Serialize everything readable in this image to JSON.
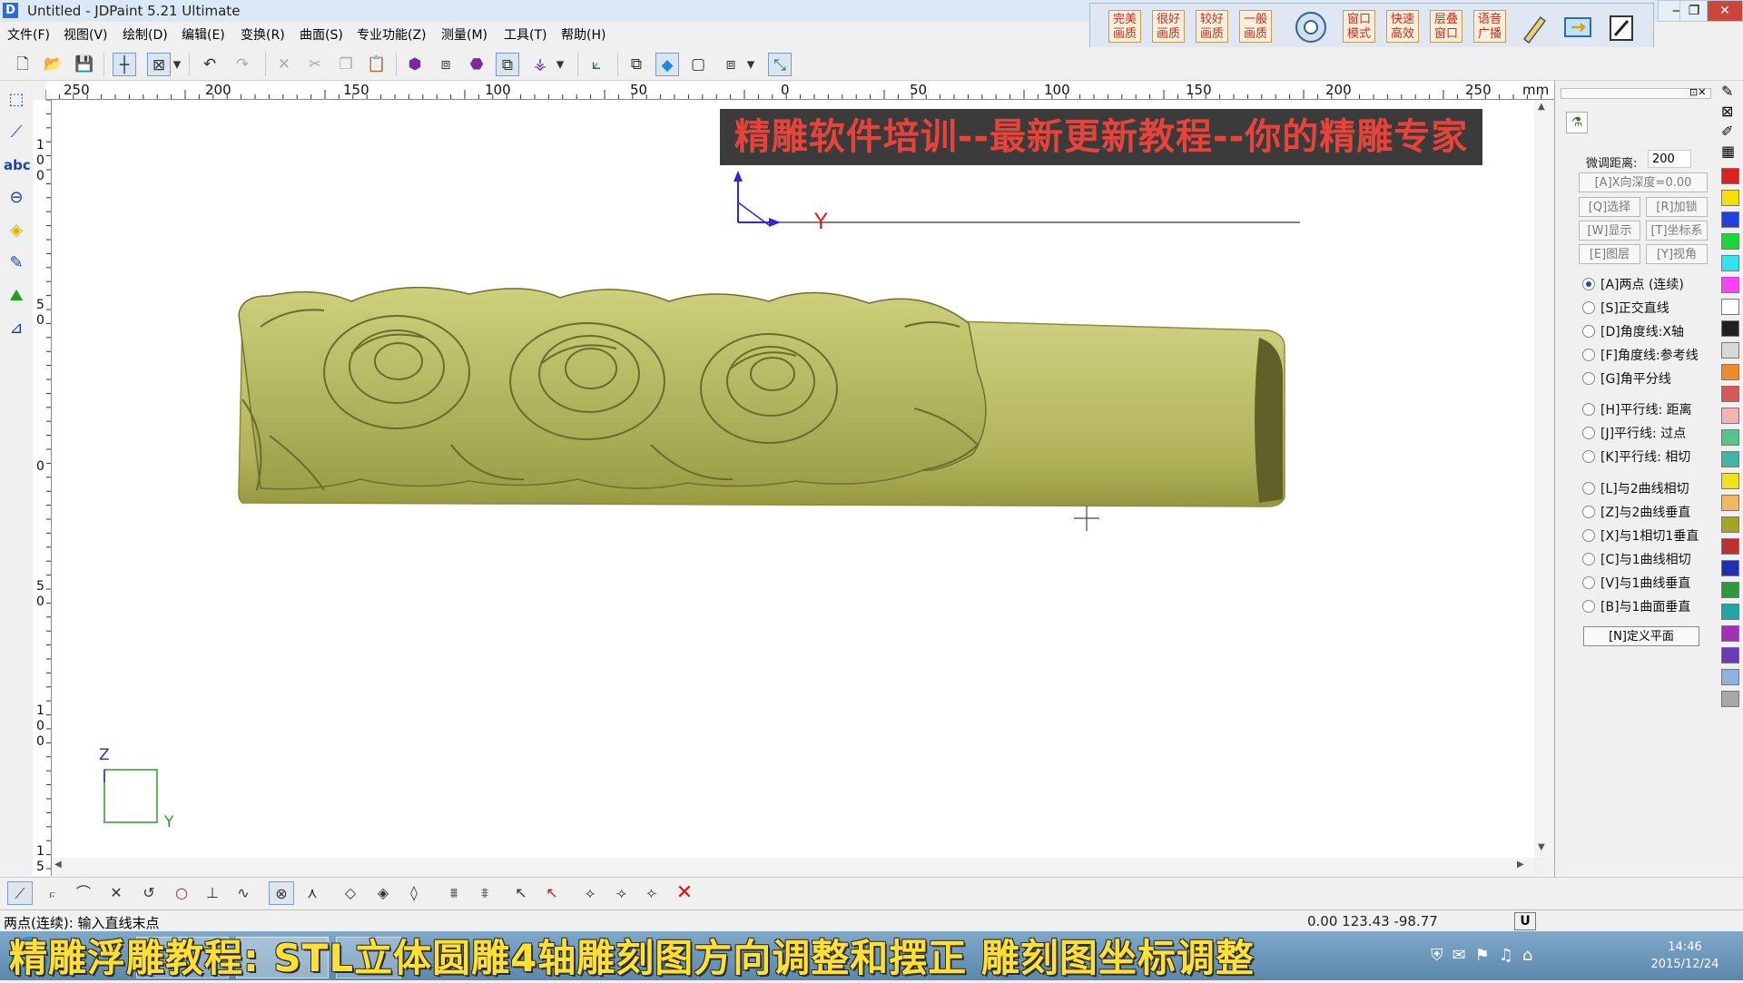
{
  "window": {
    "app_icon": "D",
    "title": "Untitled - JDPaint 5.21 Ultimate",
    "controls": {
      "minimize": "—",
      "restore": "❐",
      "close": "✕"
    }
  },
  "menu": [
    "文件(F)",
    "视图(V)",
    "绘制(D)",
    "编辑(E)",
    "变换(R)",
    "曲面(S)",
    "专业功能(Z)",
    "测量(M)",
    "工具(T)",
    "帮助(H)"
  ],
  "quick_panel": {
    "quality_buttons": [
      {
        "line1": "完美",
        "line2": "画质"
      },
      {
        "line1": "很好",
        "line2": "画质"
      },
      {
        "line1": "较好",
        "line2": "画质"
      },
      {
        "line1": "一般",
        "line2": "画质"
      }
    ],
    "mode_buttons": [
      {
        "line1": "窗口",
        "line2": "模式"
      },
      {
        "line1": "快速",
        "line2": "高效"
      },
      {
        "line1": "层叠",
        "line2": "窗口"
      },
      {
        "line1": "语音",
        "line2": "广播"
      }
    ]
  },
  "ruler": {
    "h_labels": [
      "250",
      "200",
      "150",
      "100",
      "50",
      "0",
      "50",
      "100",
      "150",
      "200",
      "250"
    ],
    "unit": "mm",
    "v_labels": [
      "1\n0\n0",
      "5\n0",
      "0",
      "5\n0",
      "1\n0\n0",
      "1\n5"
    ]
  },
  "canvas": {
    "banner": "精雕软件培训--最新更新教程--你的精雕专家",
    "axis_y_label": "Y",
    "corner_axis_z": "Z",
    "corner_axis_y": "Y"
  },
  "right_panel": {
    "fine_tune_label": "微调距离:",
    "fine_tune_value": "200",
    "depth_button": "[A]X向深度=0.00",
    "buttons": [
      "[Q]选择",
      "[R]加锁",
      "[W]显示",
      "[T]坐标系",
      "[E]图层",
      "[Y]视角"
    ],
    "options": [
      {
        "label": "[A]两点 (连续)",
        "checked": true
      },
      {
        "label": "[S]正交直线",
        "checked": false
      },
      {
        "label": "[D]角度线:X轴",
        "checked": false
      },
      {
        "label": "[F]角度线:参考线",
        "checked": false
      },
      {
        "label": "[G]角平分线",
        "checked": false
      },
      {
        "label": "[H]平行线: 距离",
        "checked": false
      },
      {
        "label": "[J]平行线: 过点",
        "checked": false
      },
      {
        "label": "[K]平行线: 相切",
        "checked": false
      },
      {
        "label": "[L]与2曲线相切",
        "checked": false
      },
      {
        "label": "[Z]与2曲线垂直",
        "checked": false
      },
      {
        "label": "[X]与1相切1垂直",
        "checked": false
      },
      {
        "label": "[C]与1曲线相切",
        "checked": false
      },
      {
        "label": "[V]与1曲线垂直",
        "checked": false
      },
      {
        "label": "[B]与1曲面垂直",
        "checked": false
      }
    ],
    "define_plane": "[N]定义平面"
  },
  "palette": [
    "#e02020",
    "#f5e100",
    "#2040e0",
    "#19d83a",
    "#2fe6f0",
    "#ff40ff",
    "#ffffff",
    "#202020",
    "#d8d8d8",
    "#ef8a2a",
    "#d65858",
    "#f4b3b3",
    "#57c48e",
    "#44b4a2",
    "#f2e21a",
    "#f2b760",
    "#a4a426",
    "#c03030",
    "#2030b0",
    "#2c9a3a",
    "#21a6a6",
    "#a22fb8",
    "#6a3bb8",
    "#8fb2de",
    "#a8a8a8"
  ],
  "status": {
    "prompt": "两点(连续): 输入直线末点",
    "coords": "0.00 123.43 -98.77",
    "mode": "U"
  },
  "caption": "精雕浮雕教程: STL立体圆雕4轴雕刻图方向调整和摆正 雕刻图坐标调整",
  "clock": {
    "time": "14:46",
    "date": "2015/12/24"
  }
}
